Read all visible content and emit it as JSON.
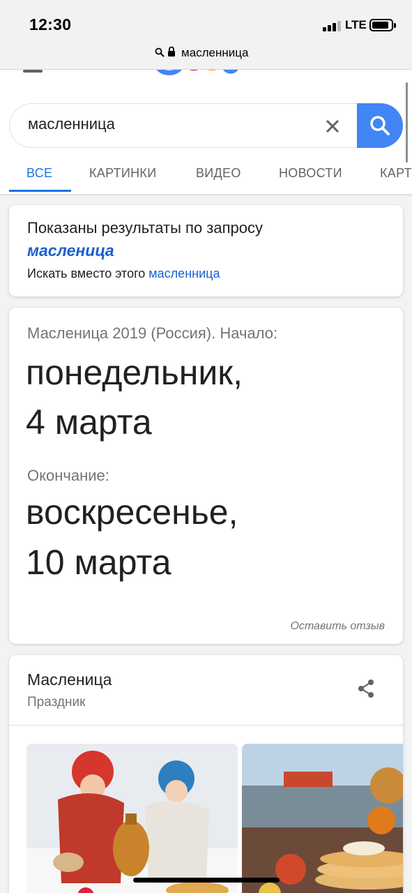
{
  "status_bar": {
    "time": "12:30",
    "network": "LTE"
  },
  "browser": {
    "url": "масленница"
  },
  "search": {
    "query": "масленница"
  },
  "tabs": [
    {
      "label": "ВСЕ",
      "active": true
    },
    {
      "label": "КАРТИНКИ",
      "active": false
    },
    {
      "label": "ВИДЕО",
      "active": false
    },
    {
      "label": "НОВОСТИ",
      "active": false
    },
    {
      "label": "КАРТЫ",
      "active": false
    }
  ],
  "correction": {
    "shown_for": "Показаны результаты по запросу",
    "corrected_term": "масленица",
    "instead_prefix": "Искать вместо этого",
    "original_term": "масленница"
  },
  "dates": {
    "heading": "Масленица 2019 (Россия). Начало:",
    "start_weekday": "понедельник,",
    "start_date": "4 марта",
    "end_label": "Окончание:",
    "end_weekday": "воскресенье,",
    "end_date": "10 марта",
    "feedback": "Оставить отзыв"
  },
  "knowledge_panel": {
    "title": "Масленица",
    "subtitle": "Праздник"
  },
  "colors": {
    "accent": "#1a73e8",
    "search_button": "#4285f4",
    "link": "#1a5fd0"
  },
  "icons": [
    "search-icon",
    "lock-icon",
    "menu-icon",
    "clear-icon",
    "share-icon"
  ]
}
